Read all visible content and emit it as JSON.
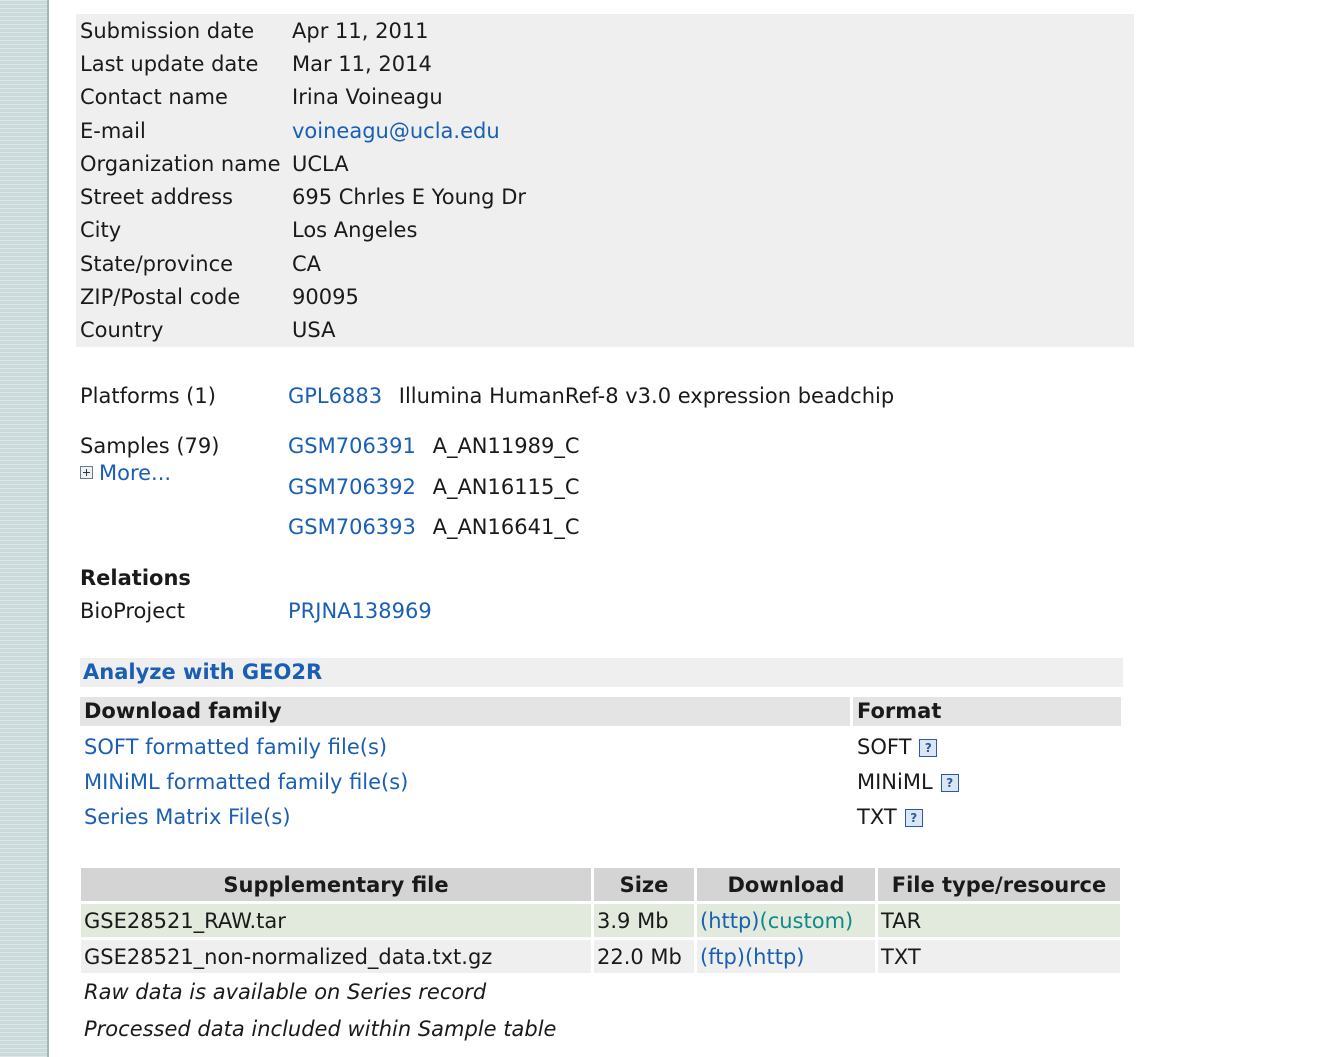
{
  "contact": [
    {
      "key": "Submission date",
      "value": "Apr 11, 2011"
    },
    {
      "key": "Last update date",
      "value": "Mar 11, 2014"
    },
    {
      "key": "Contact name",
      "value": "Irina Voineagu"
    },
    {
      "key": "E-mail",
      "value": "voineagu@ucla.edu"
    },
    {
      "key": "Organization name",
      "value": "UCLA"
    },
    {
      "key": "Street address",
      "value": "695 Chrles E Young Dr"
    },
    {
      "key": "City",
      "value": "Los Angeles"
    },
    {
      "key": "State/province",
      "value": "CA"
    },
    {
      "key": "ZIP/Postal code",
      "value": "90095"
    },
    {
      "key": "Country",
      "value": "USA"
    }
  ],
  "platforms": {
    "label": "Platforms (1)",
    "id": "GPL6883",
    "name": "Illumina HumanRef-8 v3.0 expression beadchip"
  },
  "samples": {
    "label": "Samples (79)",
    "more": "More...",
    "items": [
      {
        "id": "GSM706391",
        "name": "A_AN11989_C"
      },
      {
        "id": "GSM706392",
        "name": "A_AN16115_C"
      },
      {
        "id": "GSM706393",
        "name": "A_AN16641_C"
      }
    ]
  },
  "relations": {
    "title": "Relations",
    "key": "BioProject",
    "value": "PRJNA138969"
  },
  "geo2r": "Analyze with GEO2R",
  "download": {
    "header_family": "Download family",
    "header_format": "Format",
    "rows": [
      {
        "label": "SOFT formatted family file(s)",
        "format": "SOFT"
      },
      {
        "label": "MINiML formatted family file(s)",
        "format": "MINiML"
      },
      {
        "label": "Series Matrix File(s)",
        "format": "TXT"
      }
    ],
    "help_glyph": "?"
  },
  "supplementary": {
    "headers": [
      "Supplementary file",
      "Size",
      "Download",
      "File type/resource"
    ],
    "rows": [
      {
        "file": "GSE28521_RAW.tar",
        "size": "3.9 Mb",
        "links": [
          "(http)",
          "(custom)"
        ],
        "type": "TAR"
      },
      {
        "file": "GSE28521_non-normalized_data.txt.gz",
        "size": "22.0 Mb",
        "links": [
          "(ftp)",
          "(http)"
        ],
        "type": "TXT"
      }
    ]
  },
  "notes": [
    "Raw data is available on Series record",
    "Processed data included within Sample table"
  ]
}
